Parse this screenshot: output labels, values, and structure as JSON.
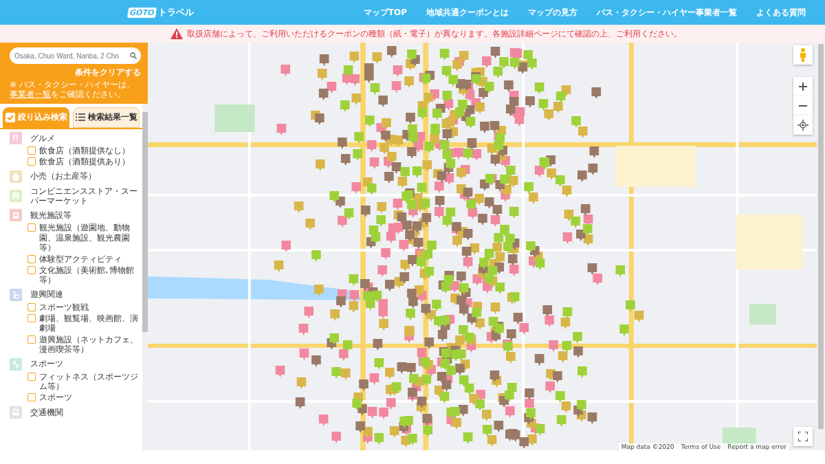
{
  "header": {
    "logo_badge": "GOTO",
    "logo_text": "トラベル",
    "nav": [
      "マップTOP",
      "地域共通クーポンとは",
      "マップの見方",
      "バス・タクシー・ハイヤー事業者一覧",
      "よくある質問"
    ]
  },
  "notice": "取扱店舗によって、ご利用いただけるクーポンの種類（紙・電子）が異なります。各施設詳細ページにて確認の上、ご利用ください。",
  "sidebar": {
    "search": {
      "value": "Osaka, Chuo Ward, Nanba, 2 Cho"
    },
    "clear_link": "条件をクリアする",
    "note_before": "※ バス・タクシー・ハイヤーは、",
    "note_link": "事業者一覧",
    "note_after": "をご確認ください。",
    "tabs": [
      {
        "label": "絞り込み検索",
        "selected": true,
        "kind": "check"
      },
      {
        "label": "検索結果一覧",
        "selected": false,
        "kind": "list"
      }
    ],
    "categories": [
      {
        "label": "グルメ",
        "kind": "cutlery",
        "color": "#f8c8d8",
        "items": [
          {
            "label": "飲食店（酒類提供なし）",
            "checked": false
          },
          {
            "label": "飲食店（酒類提供あり）",
            "checked": false
          }
        ]
      },
      {
        "label": "小売（お土産等）",
        "kind": "bag",
        "color": "#efe2c2"
      },
      {
        "label": "コンビニエンスストア・スーパーマーケット",
        "kind": "store",
        "color": "#dcefc4"
      },
      {
        "label": "観光施設等",
        "kind": "building",
        "color": "#f6c9c9",
        "items": [
          {
            "label": "観光施設（遊園地、動物園、温泉施設、観光農園等）",
            "checked": false
          },
          {
            "label": "体験型アクティビティ",
            "checked": false
          },
          {
            "label": "文化施設（美術館､博物館等）",
            "checked": false
          }
        ]
      },
      {
        "label": "遊興関連",
        "kind": "figure",
        "color": "#c9d7f0",
        "items": [
          {
            "label": "スポーツ観戦",
            "checked": false
          },
          {
            "label": "劇場、観覧場、映画館、演劇場",
            "checked": false
          },
          {
            "label": "遊興施設（ネットカフェ、漫画喫茶等）",
            "checked": false
          }
        ]
      },
      {
        "label": "スポーツ",
        "kind": "steps",
        "color": "#c6ebe3",
        "items": [
          {
            "label": "フィットネス（スポーツジム等）",
            "checked": false
          },
          {
            "label": "スポーツ",
            "checked": false
          }
        ]
      },
      {
        "label": "交通機関",
        "kind": "bus",
        "color": "#e2e2e2"
      }
    ]
  },
  "map": {
    "attribution": [
      "Map data ©2020",
      "Terms of Use",
      "Report a map error"
    ]
  }
}
